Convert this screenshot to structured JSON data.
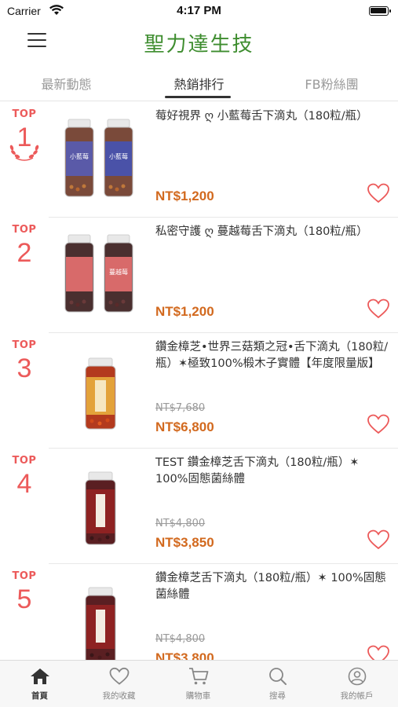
{
  "status_bar": {
    "carrier": "Carrier",
    "time": "4:17 PM",
    "battery_level": 1.0
  },
  "header": {
    "logo_text": "聖力達生技",
    "logo_color": "#3e8d2f",
    "menu_icon": "hamburger-menu-icon"
  },
  "tabs": [
    {
      "label": "最新動態",
      "active": false
    },
    {
      "label": "熱銷排行",
      "active": true
    },
    {
      "label": "FB粉絲團",
      "active": false
    }
  ],
  "products": [
    {
      "rank_label": "TOP",
      "rank": "1",
      "name": "莓好視界 ღ 小藍莓舌下滴丸（180粒/瓶）",
      "old_price": "",
      "price": "NT$1,200",
      "bottle_label_1": "小藍莓",
      "bottle_label_2": "小藍莓"
    },
    {
      "rank_label": "TOP",
      "rank": "2",
      "name": "私密守護 ღ 蔓越莓舌下滴丸（180粒/瓶）",
      "old_price": "",
      "price": "NT$1,200",
      "bottle_label_1": "",
      "bottle_label_2": "蔓越莓"
    },
    {
      "rank_label": "TOP",
      "rank": "3",
      "name": "鑽金樟芝•世界三菇類之冠•舌下滴丸（180粒/瓶）✶極致100%椴木子實體【年度限量版】",
      "old_price": "NT$7,680",
      "price": "NT$6,800"
    },
    {
      "rank_label": "TOP",
      "rank": "4",
      "name": "TEST 鑽金樟芝舌下滴丸（180粒/瓶）✶ 100%固態菌絲體",
      "old_price": "NT$4,800",
      "price": "NT$3,850"
    },
    {
      "rank_label": "TOP",
      "rank": "5",
      "name": "鑽金樟芝舌下滴丸（180粒/瓶）✶ 100%固態菌絲體",
      "old_price": "NT$4,800",
      "price": "NT$3,800"
    }
  ],
  "colors": {
    "accent": "#ec5a5a",
    "price": "#d2691e"
  },
  "bottom_nav": [
    {
      "label": "首頁",
      "icon": "home-icon",
      "active": true
    },
    {
      "label": "我的收藏",
      "icon": "heart-icon",
      "active": false
    },
    {
      "label": "購物車",
      "icon": "cart-icon",
      "active": false
    },
    {
      "label": "搜尋",
      "icon": "search-icon",
      "active": false
    },
    {
      "label": "我的帳戶",
      "icon": "account-icon",
      "active": false
    }
  ]
}
